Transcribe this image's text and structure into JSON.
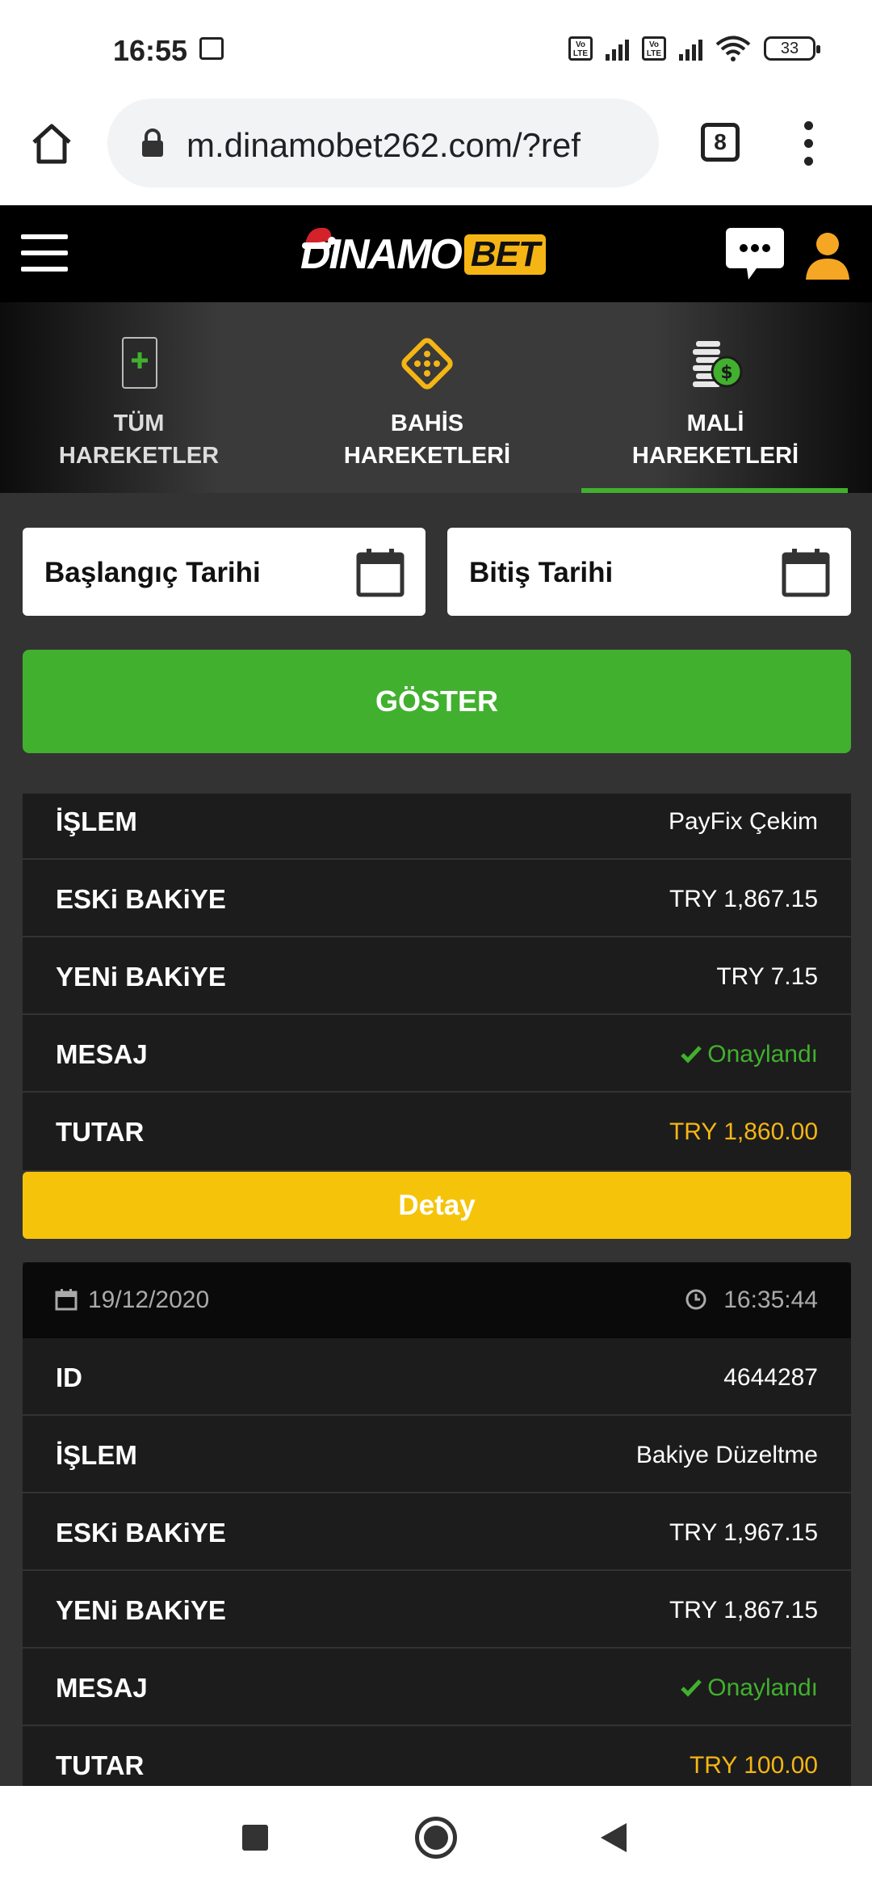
{
  "status_bar": {
    "time": "16:55",
    "volte_1": "Vo LTE",
    "volte_2": "Vo LTE",
    "battery": "33"
  },
  "browser": {
    "url": "m.dinamobet262.com/?ref",
    "tab_count": "8"
  },
  "header": {
    "logo_main": "DINAMO",
    "logo_bet": "BET"
  },
  "tabs": [
    {
      "label": "TÜM\nHAREKETLER",
      "icon": "plus-icon"
    },
    {
      "label": "BAHİS\nHAREKETLERİ",
      "icon": "dice-icon"
    },
    {
      "label": "MALİ\nHAREKETLERİ",
      "icon": "coins-icon",
      "active": true
    }
  ],
  "filters": {
    "start_date_label": "Başlangıç Tarihi",
    "end_date_label": "Bitiş Tarihi",
    "show_button": "GÖSTER"
  },
  "transactions": [
    {
      "rows": [
        {
          "label": "İŞLEM",
          "value": "PayFix Çekim"
        },
        {
          "label": "ESKi BAKiYE",
          "value": "TRY 1,867.15"
        },
        {
          "label": "YENi BAKiYE",
          "value": "TRY 7.15"
        },
        {
          "label": "MESAJ",
          "value": "Onaylandı"
        },
        {
          "label": "TUTAR",
          "value": "TRY 1,860.00"
        }
      ],
      "detail_button": "Detay"
    },
    {
      "date": "19/12/2020",
      "time": "16:35:44",
      "rows": [
        {
          "label": "ID",
          "value": "4644287"
        },
        {
          "label": "İŞLEM",
          "value": "Bakiye Düzeltme"
        },
        {
          "label": "ESKi BAKiYE",
          "value": "TRY 1,967.15"
        },
        {
          "label": "YENi BAKiYE",
          "value": "TRY 1,867.15"
        },
        {
          "label": "MESAJ",
          "value": "Onaylandı"
        },
        {
          "label": "TUTAR",
          "value": "TRY 100.00"
        }
      ]
    }
  ],
  "colors": {
    "accent_green": "#41b02e",
    "accent_yellow": "#f5b514",
    "detail_yellow": "#f5c40a",
    "card_bg": "#1c1c1c",
    "page_bg": "#333333"
  }
}
